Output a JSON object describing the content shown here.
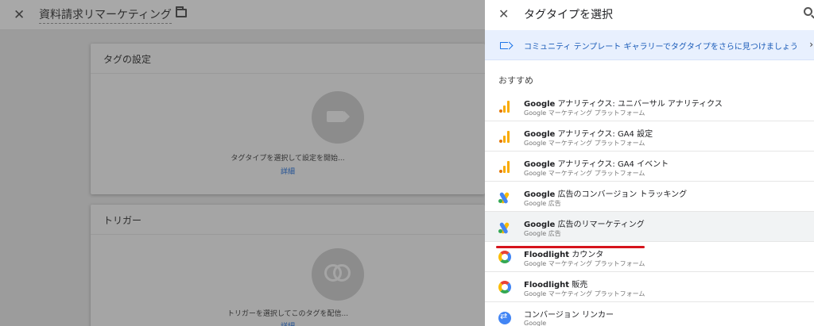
{
  "workspace": {
    "title": "資料請求リマーケティング",
    "tag_card": {
      "heading": "タグの設定",
      "hint": "タグタイプを選択して設定を開始...",
      "link": "詳細"
    },
    "trigger_card": {
      "heading": "トリガー",
      "hint": "トリガーを選択してこのタグを配信...",
      "link": "詳細"
    }
  },
  "panel": {
    "title": "タグタイプを選択",
    "banner_text": "コミュニティ テンプレート ギャラリーでタグタイプをさらに見つけましょう",
    "section_label": "おすすめ",
    "items": [
      {
        "brand": "Google",
        "name": " アナリティクス: ユニバーサル アナリティクス",
        "sub": "Google マーケティング プラットフォーム",
        "icon": "analytics-icon"
      },
      {
        "brand": "Google",
        "name": " アナリティクス: GA4 設定",
        "sub": "Google マーケティング プラットフォーム",
        "icon": "analytics-icon"
      },
      {
        "brand": "Google",
        "name": " アナリティクス: GA4 イベント",
        "sub": "Google マーケティング プラットフォーム",
        "icon": "analytics-icon"
      },
      {
        "brand": "Google",
        "name": " 広告のコンバージョン トラッキング",
        "sub": "Google 広告",
        "icon": "google-ads-icon"
      },
      {
        "brand": "Google",
        "name": " 広告のリマーケティング",
        "sub": "Google 広告",
        "icon": "google-ads-icon"
      },
      {
        "brand": "Floodlight",
        "name": " カウンタ",
        "sub": "Google マーケティング プラットフォーム",
        "icon": "floodlight-icon"
      },
      {
        "brand": "Floodlight",
        "name": " 販売",
        "sub": "Google マーケティング プラットフォーム",
        "icon": "floodlight-icon"
      },
      {
        "brand": "",
        "name": "コンバージョン リンカー",
        "sub": "Google",
        "icon": "conversion-linker-icon"
      }
    ]
  },
  "colors": {
    "accent_blue": "#1a73e8",
    "highlight_underline": "#d6141c",
    "banner_bg": "#e8f0fe"
  }
}
